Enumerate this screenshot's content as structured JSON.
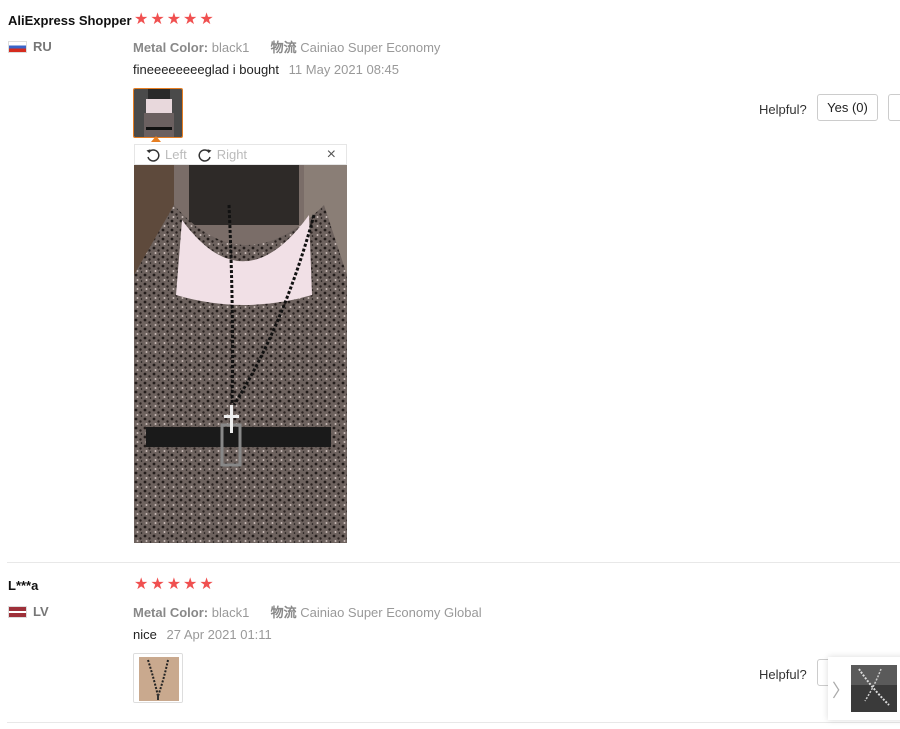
{
  "reviews": [
    {
      "user": "AliExpress Shopper",
      "country_code": "RU",
      "rating": 5,
      "attr_label": "Metal Color:",
      "attr_value": "black1",
      "logistics_label": "物流",
      "logistics_value": "Cainiao Super Economy",
      "feedback": "fineeeeeeeeglad i bought",
      "time": "11 May 2021 08:45",
      "helpful_label": "Helpful?",
      "yes_label": "Yes (0)"
    },
    {
      "user": "L***a",
      "country_code": "LV",
      "rating": 5,
      "attr_label": "Metal Color:",
      "attr_value": "black1",
      "logistics_label": "物流",
      "logistics_value": "Cainiao Super Economy Global",
      "feedback": "nice",
      "time": "27 Apr 2021 01:11",
      "helpful_label": "Helpful?"
    }
  ],
  "viewer": {
    "rotate_left_label": "Left",
    "rotate_right_label": "Right",
    "close_label": "×"
  },
  "icons": {
    "star": "★",
    "rotate_left": "rotate-left-icon",
    "rotate_right": "rotate-right-icon",
    "next": "chevron-right-icon"
  },
  "side_panel": {
    "arrow": "〉"
  },
  "colors": {
    "star": "#f05050",
    "active_thumb_border": "#e67e22"
  }
}
